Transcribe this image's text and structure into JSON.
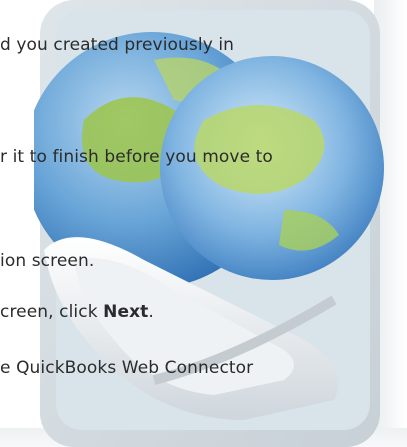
{
  "icon": "web-connector-globe-icon",
  "colors": {
    "text": "#2b2b2b",
    "globe_blue": "#3a80c8",
    "globe_green": "#9cc64a",
    "tray": "#e6e9ec"
  },
  "lines": [
    "d you created previously in",
    "r it to finish before you move to",
    "ion screen.",
    "creen, click ",
    "e QuickBooks Web Connector"
  ],
  "next_label": "Next",
  "period": "."
}
